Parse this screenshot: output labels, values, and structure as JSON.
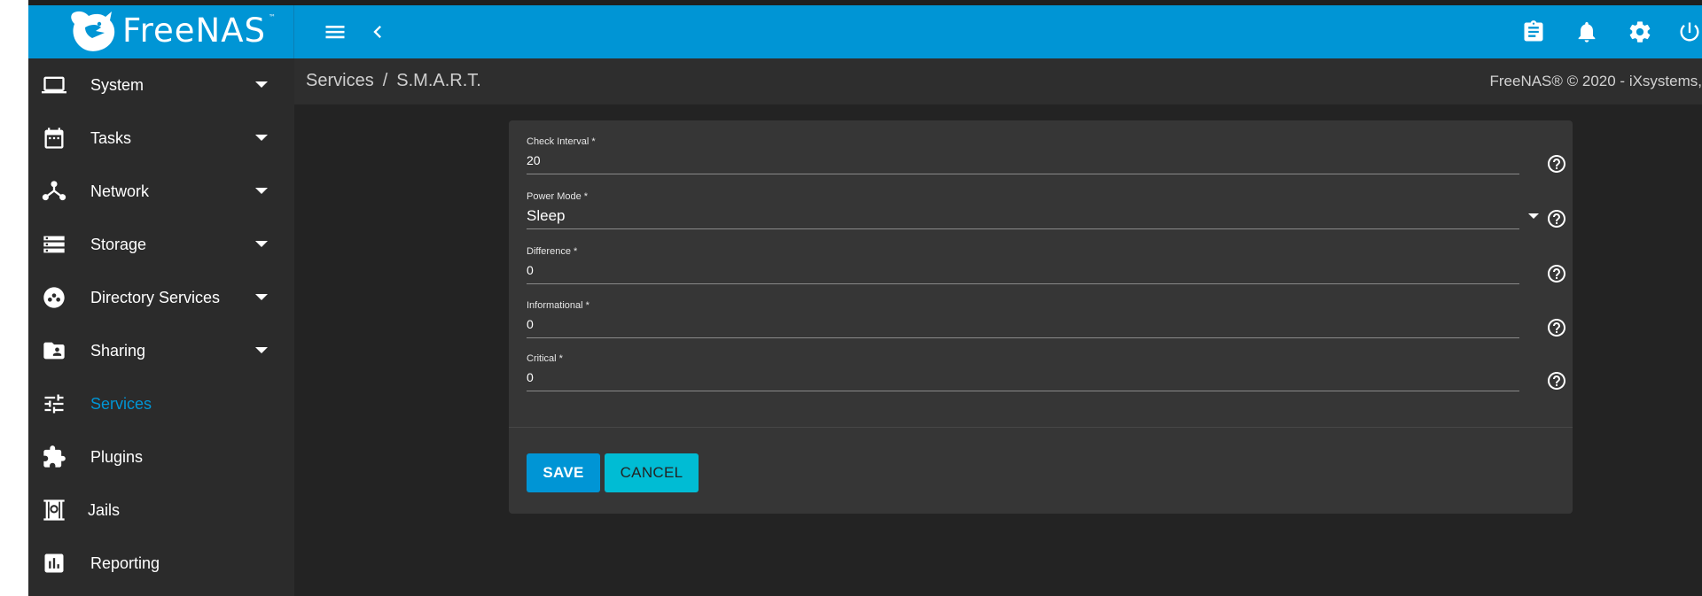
{
  "app": {
    "logo_text": "FreeNAS",
    "logo_tm": "™",
    "accent_color": "#0095d5"
  },
  "topbar": {
    "menu_icon": "hamburger-menu-icon",
    "collapse_icon": "chevron-left-icon",
    "right_icons": [
      "clipboard-icon",
      "bell-icon",
      "gear-icon",
      "power-icon"
    ]
  },
  "sidebar": {
    "items": [
      {
        "label": "System",
        "icon": "laptop-icon",
        "expandable": true
      },
      {
        "label": "Tasks",
        "icon": "calendar-icon",
        "expandable": true
      },
      {
        "label": "Network",
        "icon": "network-icon",
        "expandable": true
      },
      {
        "label": "Storage",
        "icon": "storage-icon",
        "expandable": true
      },
      {
        "label": "Directory Services",
        "icon": "directory-icon",
        "expandable": true
      },
      {
        "label": "Sharing",
        "icon": "folder-shared-icon",
        "expandable": true
      },
      {
        "label": "Services",
        "icon": "tune-icon",
        "expandable": false,
        "active": true
      },
      {
        "label": "Plugins",
        "icon": "puzzle-icon",
        "expandable": false
      },
      {
        "label": "Jails",
        "icon": "jail-icon",
        "expandable": false
      },
      {
        "label": "Reporting",
        "icon": "chart-icon",
        "expandable": false
      }
    ]
  },
  "breadcrumb": {
    "parent": "Services",
    "separator": "/",
    "current": "S.M.A.R.T."
  },
  "copyright": "FreeNAS® © 2020 - iXsystems,",
  "form": {
    "fields": [
      {
        "label": "Check Interval *",
        "value": "20",
        "type": "input"
      },
      {
        "label": "Power Mode *",
        "value": "Sleep",
        "type": "select"
      },
      {
        "label": "Difference *",
        "value": "0",
        "type": "input"
      },
      {
        "label": "Informational *",
        "value": "0",
        "type": "input"
      },
      {
        "label": "Critical *",
        "value": "0",
        "type": "input"
      }
    ],
    "save_label": "SAVE",
    "cancel_label": "CANCEL"
  }
}
